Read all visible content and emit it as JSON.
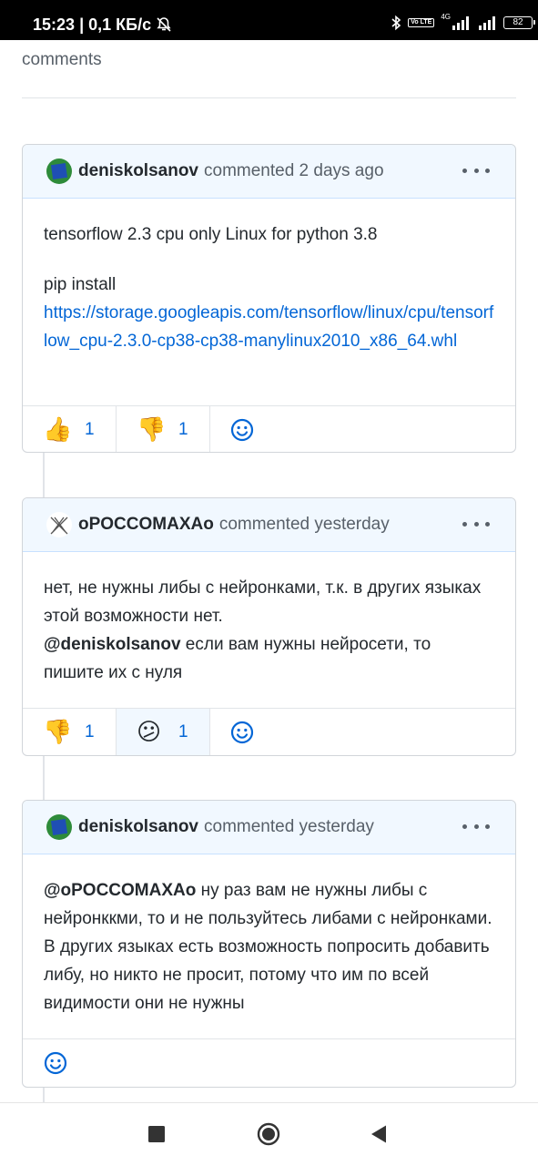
{
  "status_bar": {
    "time": "15:23",
    "separator": "|",
    "speed": "0,1 КБ/с",
    "network_badge": "Vo LTE",
    "network_type": "4G",
    "battery": "82",
    "icons": [
      "mute-icon",
      "bluetooth-icon",
      "signal-icon",
      "signal-icon-2",
      "battery-icon"
    ]
  },
  "top_text": "comments",
  "comments": [
    {
      "author": "deniskolsanov",
      "meta": "commented 2 days ago",
      "body": {
        "line1": "tensorflow 2.3 cpu only Linux for python 3.8",
        "pip_label": "pip install",
        "link": "https://storage.googleapis.com/tensorflow/linux/cpu/tensorflow_cpu-2.3.0-cp38-cp38-manylinux2010_x86_64.whl"
      },
      "reactions": [
        {
          "emoji": "👍",
          "icon": "thumbs-up-icon",
          "count": "1"
        },
        {
          "emoji": "👎",
          "icon": "thumbs-down-icon",
          "count": "1"
        }
      ]
    },
    {
      "author": "оPOCCOMAXAо",
      "meta": "commented yesterday",
      "body": {
        "text1": "нет, не нужны либы с нейронками, т.к. в других языках этой возможности нет.",
        "mention": "@deniskolsanov",
        "text2": " если вам нужны нейросети, то пишите их с нуля"
      },
      "reactions": [
        {
          "emoji": "👎",
          "icon": "thumbs-down-icon",
          "count": "1"
        },
        {
          "emoji": "😕",
          "icon": "confused-icon",
          "count": "1"
        }
      ]
    },
    {
      "author": "deniskolsanov",
      "meta": "commented yesterday",
      "body": {
        "mention": "@оPOCCOMAXAо",
        "text": " ну раз вам не нужны либы с нейронккми, то и не пользуйтесь либами с нейронками. В других языках есть возможность попросить добавить либу, но никто не просит, потому что им по всей видимости они не нужны"
      }
    }
  ],
  "colors": {
    "link": "#0366d6",
    "header_bg": "#f1f8ff",
    "border": "#d1d5da",
    "muted_text": "#586069"
  }
}
